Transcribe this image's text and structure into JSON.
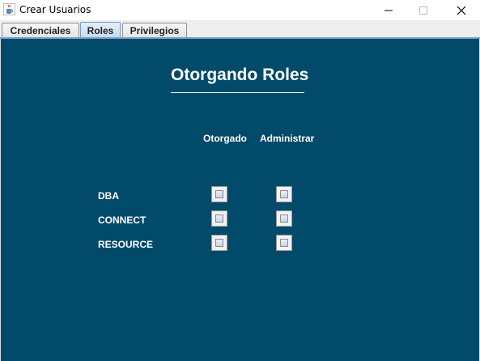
{
  "window": {
    "title": "Crear Usuarios",
    "app_icon": "java-cup-icon"
  },
  "tabs": [
    {
      "label": "Credenciales",
      "selected": false
    },
    {
      "label": "Roles",
      "selected": true
    },
    {
      "label": "Privilegios",
      "selected": false
    }
  ],
  "panel": {
    "heading": "Otorgando Roles",
    "columns": {
      "granted": "Otorgado",
      "admin": "Administrar"
    },
    "rows": [
      {
        "label": "DBA",
        "granted": false,
        "admin": false
      },
      {
        "label": "CONNECT",
        "granted": false,
        "admin": false
      },
      {
        "label": "RESOURCE",
        "granted": false,
        "admin": false
      }
    ]
  },
  "colors": {
    "panel_background": "#024a6a",
    "text": "#ffffff"
  }
}
